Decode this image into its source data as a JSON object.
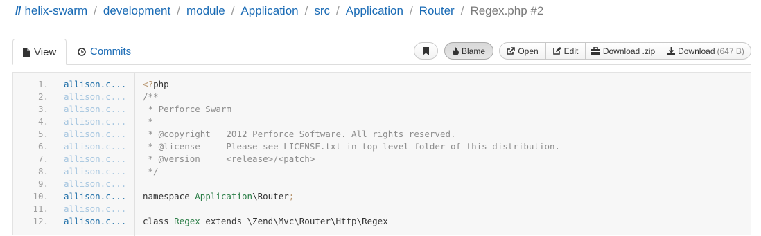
{
  "breadcrumb": {
    "home": "//",
    "items": [
      "helix-swarm",
      "development",
      "module",
      "Application",
      "src",
      "Application",
      "Router"
    ],
    "current": "Regex.php #2",
    "separator": "/"
  },
  "tabs": [
    {
      "label": "View",
      "icon": "file-icon",
      "active": true
    },
    {
      "label": "Commits",
      "icon": "clock-icon",
      "active": false
    }
  ],
  "toolbar": {
    "blame_label": "Blame",
    "open_label": "Open",
    "edit_label": "Edit",
    "download_zip_label": "Download .zip",
    "download_label": "Download",
    "download_size": "(647 B)"
  },
  "code": {
    "lines": [
      {
        "num": "1.",
        "author": "allison.c...",
        "author_style": "dark",
        "text": "<?php"
      },
      {
        "num": "2.",
        "author": "allison.c...",
        "author_style": "light",
        "text": "/**"
      },
      {
        "num": "3.",
        "author": "allison.c...",
        "author_style": "light",
        "text": " * Perforce Swarm"
      },
      {
        "num": "4.",
        "author": "allison.c...",
        "author_style": "light",
        "text": " *"
      },
      {
        "num": "5.",
        "author": "allison.c...",
        "author_style": "light",
        "text": " * @copyright   2012 Perforce Software. All rights reserved."
      },
      {
        "num": "6.",
        "author": "allison.c...",
        "author_style": "light",
        "text": " * @license     Please see LICENSE.txt in top-level folder of this distribution."
      },
      {
        "num": "7.",
        "author": "allison.c...",
        "author_style": "light",
        "text": " * @version     <release>/<patch>"
      },
      {
        "num": "8.",
        "author": "allison.c...",
        "author_style": "light",
        "text": " */"
      },
      {
        "num": "9.",
        "author": "allison.c...",
        "author_style": "light",
        "text": ""
      },
      {
        "num": "10.",
        "author": "allison.c...",
        "author_style": "dark",
        "text": "namespace Application\\Router;"
      },
      {
        "num": "11.",
        "author": "allison.c...",
        "author_style": "light",
        "text": ""
      },
      {
        "num": "12.",
        "author": "allison.c...",
        "author_style": "dark",
        "text": "class Regex extends \\Zend\\Mvc\\Router\\Http\\Regex"
      }
    ]
  }
}
